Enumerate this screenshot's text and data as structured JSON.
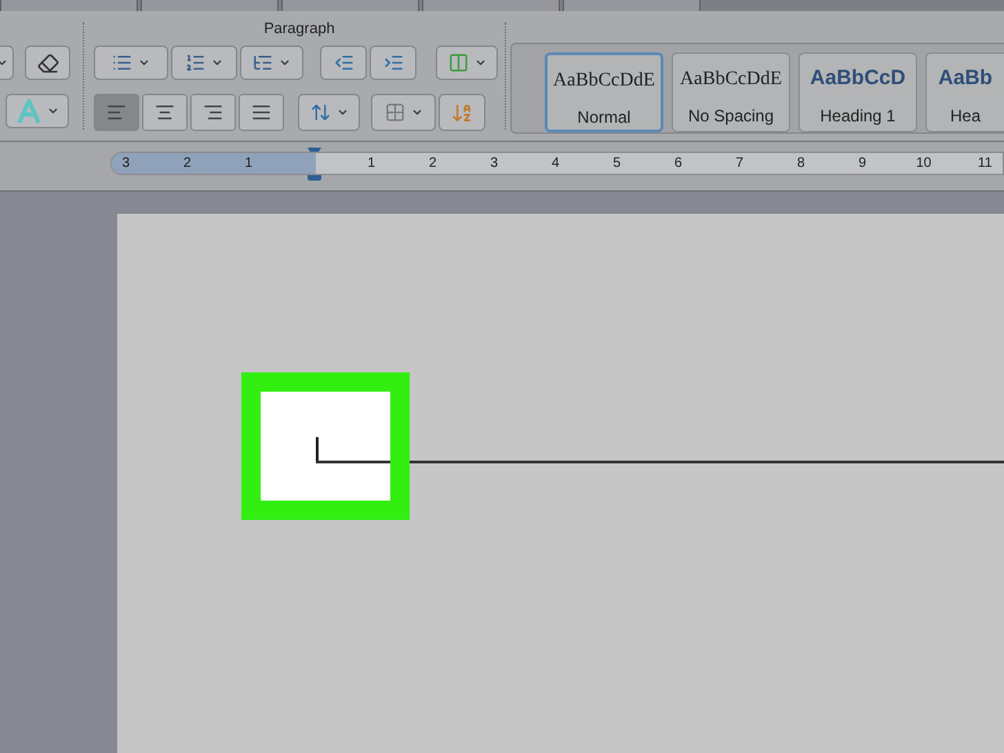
{
  "ribbon": {
    "tabs": [
      {
        "selected": false
      },
      {
        "selected": false
      },
      {
        "selected": false
      },
      {
        "selected": false
      },
      {
        "selected": false
      }
    ],
    "group_label": "Paragraph",
    "alignment": [
      {
        "kind": "left",
        "selected": true
      },
      {
        "kind": "center",
        "selected": false
      },
      {
        "kind": "right",
        "selected": false
      },
      {
        "kind": "justify",
        "selected": false
      }
    ],
    "styles": [
      {
        "kind": "body",
        "preview": "AaBbCcDdE",
        "label": "Normal",
        "selected": true
      },
      {
        "kind": "body",
        "preview": "AaBbCcDdE",
        "label": "No Spacing",
        "selected": false
      },
      {
        "kind": "heading",
        "preview": "AaBbCcD",
        "label": "Heading 1",
        "selected": false
      },
      {
        "kind": "heading",
        "preview": "AaBb",
        "label": "Hea",
        "selected": false
      }
    ]
  },
  "ruler": {
    "left_numbers": [
      "3",
      "2",
      "1"
    ],
    "right_numbers": [
      "1",
      "2",
      "3",
      "4",
      "5",
      "6",
      "7",
      "8",
      "9",
      "10",
      "11"
    ]
  }
}
